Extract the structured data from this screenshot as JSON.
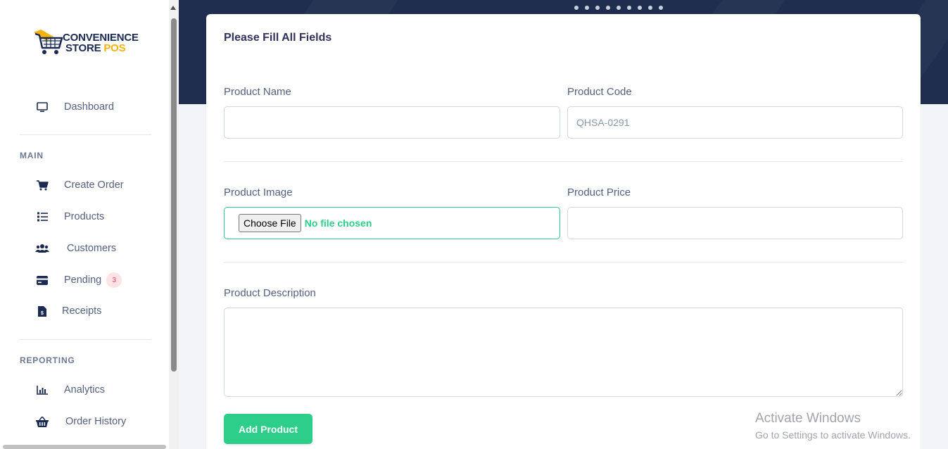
{
  "brand": {
    "line1": "CONVENIENCE",
    "line2_a": "STORE",
    "line2_b": "POS"
  },
  "sidebar": {
    "dashboard": "Dashboard",
    "section_main": "MAIN",
    "section_reporting": "REPORTING",
    "items": [
      {
        "label": "Create Order",
        "icon": "cart-icon"
      },
      {
        "label": "Products",
        "icon": "list-icon"
      },
      {
        "label": "Customers",
        "icon": "users-icon"
      },
      {
        "label": "Pending",
        "icon": "credit-card-icon",
        "badge": "3"
      },
      {
        "label": "Receipts",
        "icon": "receipt-icon"
      }
    ],
    "reporting": [
      {
        "label": "Analytics",
        "icon": "bar-chart-icon"
      },
      {
        "label": "Order History",
        "icon": "basket-icon"
      }
    ]
  },
  "form": {
    "title": "Please Fill All Fields",
    "product_name_label": "Product Name",
    "product_name_value": "",
    "product_code_label": "Product Code",
    "product_code_placeholder": "QHSA-0291",
    "product_image_label": "Product Image",
    "choose_file_label": "Choose File",
    "file_status": "No file chosen",
    "product_price_label": "Product Price",
    "product_price_value": "",
    "product_description_label": "Product Description",
    "product_description_value": "",
    "submit_label": "Add Product"
  },
  "watermark": {
    "line1": "Activate Windows",
    "line2": "Go to Settings to activate Windows."
  },
  "colors": {
    "accent": "#2dce89",
    "header": "#1f2d4f",
    "badge": "#f5365c",
    "brand_yellow": "#f4b20a",
    "brand_navy": "#1b2a52"
  }
}
